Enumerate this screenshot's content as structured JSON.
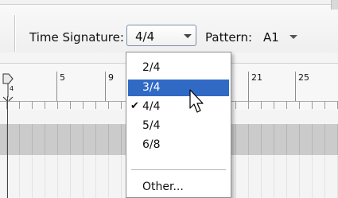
{
  "toolbar": {
    "time_signature_label": "Time Signature:",
    "time_signature_value": "4/4",
    "pattern_label": "Pattern:",
    "pattern_value": "A1"
  },
  "ruler": {
    "bar_numbers": [
      "5",
      "9",
      "21",
      "25"
    ],
    "start_marker_label": "4"
  },
  "dropdown": {
    "items": [
      {
        "label": "2/4",
        "selected": false,
        "checked": false
      },
      {
        "label": "3/4",
        "selected": true,
        "checked": false
      },
      {
        "label": "4/4",
        "selected": false,
        "checked": true
      },
      {
        "label": "5/4",
        "selected": false,
        "checked": false
      },
      {
        "label": "6/8",
        "selected": false,
        "checked": false
      }
    ],
    "other_label": "Other...",
    "check_glyph": "✔"
  },
  "colors": {
    "highlight": "#316ac5",
    "lane_gray": "#cbcbcb"
  }
}
